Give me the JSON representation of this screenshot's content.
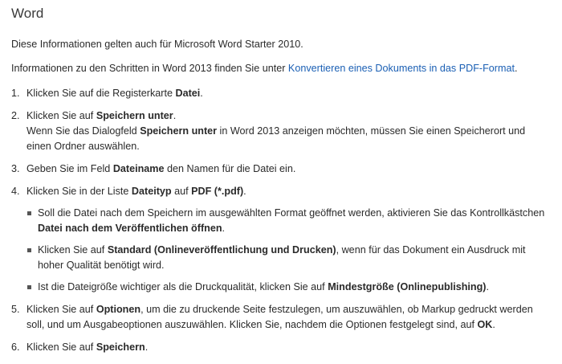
{
  "heading": "Word",
  "note": "Diese Informationen gelten auch für Microsoft Word Starter 2010.",
  "note2": {
    "prefix": "Informationen zu den Schritten in Word 2013 finden Sie unter ",
    "link": "Konvertieren eines Dokuments in das PDF-Format",
    "suffix": "."
  },
  "steps": [
    {
      "num": "1.",
      "t1": "Klicken Sie auf die Registerkarte ",
      "b1": "Datei",
      "t2": "."
    },
    {
      "num": "2.",
      "t1": "Klicken Sie auf ",
      "b1": "Speichern unter",
      "t2": ".",
      "sub_t1": "Wenn Sie das Dialogfeld ",
      "sub_b1": "Speichern unter",
      "sub_t2": " in Word 2013 anzeigen möchten, müssen Sie einen Speicherort und einen Ordner auswählen."
    },
    {
      "num": "3.",
      "t1": "Geben Sie im Feld ",
      "b1": "Dateiname",
      "t2": " den Namen für die Datei ein."
    },
    {
      "num": "4.",
      "t1": "Klicken Sie in der Liste ",
      "b1": "Dateityp",
      "t2": " auf ",
      "b2": "PDF (*.pdf)",
      "t3": ".",
      "bullets": [
        {
          "t1": "Soll die Datei nach dem Speichern im ausgewählten Format geöffnet werden, aktivieren Sie das Kontrollkästchen ",
          "b1": "Datei nach dem Veröffentlichen öffnen",
          "t2": "."
        },
        {
          "t1": "Klicken Sie auf ",
          "b1": "Standard (Onlineveröffentlichung und Drucken)",
          "t2": ", wenn für das Dokument ein Ausdruck mit hoher Qualität benötigt wird."
        },
        {
          "t1": "Ist die Dateigröße wichtiger als die Druckqualität, klicken Sie auf ",
          "b1": "Mindestgröße (Onlinepublishing)",
          "t2": "."
        }
      ]
    },
    {
      "num": "5.",
      "t1": "Klicken Sie auf ",
      "b1": "Optionen",
      "t2": ", um die zu druckende Seite festzulegen, um auszuwählen, ob Markup gedruckt werden soll, und um Ausgabeoptionen auszuwählen. Klicken Sie, nachdem die Optionen festgelegt sind, auf ",
      "b2": "OK",
      "t3": "."
    },
    {
      "num": "6.",
      "t1": "Klicken Sie auf ",
      "b1": "Speichern",
      "t2": "."
    }
  ],
  "colors": {
    "link": "#1a5fb4",
    "text": "#2a2a2a",
    "background": "#ffffff"
  }
}
